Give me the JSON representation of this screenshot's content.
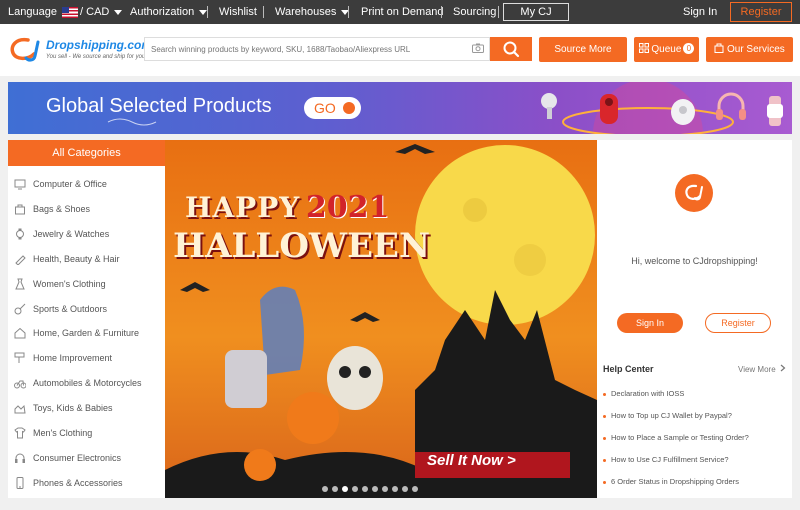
{
  "topbar": {
    "language": "Language",
    "currency": "/ CAD",
    "authorization": "Authorization",
    "wishlist": "Wishlist",
    "warehouses": "Warehouses",
    "print_on_demand": "Print on Demand",
    "sourcing": "Sourcing",
    "my_cj": "My CJ",
    "sign_in": "Sign In",
    "register": "Register"
  },
  "header": {
    "logo_text": "Dropshipping.com",
    "logo_tagline": "You sell - We source and ship for you!",
    "search_placeholder": "Search winning products by keyword, SKU, 1688/Taobao/Aliexpress URL",
    "source_more": "Source More",
    "queue": "Queue",
    "queue_count": "0",
    "our_services": "Our Services"
  },
  "banner": {
    "title": "Global Selected Products",
    "go": "GO"
  },
  "categories": {
    "heading": "All Categories",
    "items": [
      {
        "label": "Computer & Office",
        "icon": "computer-icon"
      },
      {
        "label": "Bags & Shoes",
        "icon": "bag-icon"
      },
      {
        "label": "Jewelry & Watches",
        "icon": "watch-icon"
      },
      {
        "label": "Health, Beauty & Hair",
        "icon": "beauty-icon"
      },
      {
        "label": "Women's Clothing",
        "icon": "dress-icon"
      },
      {
        "label": "Sports & Outdoors",
        "icon": "sports-icon"
      },
      {
        "label": "Home, Garden & Furniture",
        "icon": "home-icon"
      },
      {
        "label": "Home Improvement",
        "icon": "tool-icon"
      },
      {
        "label": "Automobiles & Motorcycles",
        "icon": "motorcycle-icon"
      },
      {
        "label": "Toys, Kids & Babies",
        "icon": "toy-icon"
      },
      {
        "label": "Men's Clothing",
        "icon": "shirt-icon"
      },
      {
        "label": "Consumer Electronics",
        "icon": "headphones-icon"
      },
      {
        "label": "Phones & Accessories",
        "icon": "phone-icon"
      }
    ]
  },
  "hero": {
    "line1_word": "HAPPY",
    "line1_year": "2021",
    "line2": "HALLOWEEN",
    "cta": "Sell It Now >",
    "slide_count": 10,
    "active_slide": 3
  },
  "account": {
    "welcome": "Hi, welcome to CJdropshipping!",
    "sign_in": "Sign In",
    "register": "Register"
  },
  "help": {
    "title": "Help Center",
    "view_more": "View More",
    "items": [
      "Declaration with IOSS",
      "How to Top up CJ Wallet by Paypal?",
      "How to Place a Sample or Testing Order?",
      "How to Use CJ Fulfillment Service?",
      "6 Order Status in Dropshipping Orders"
    ]
  },
  "colors": {
    "accent": "#f46a23",
    "topbar": "#3c3c3c",
    "logo_blue": "#1e88e5"
  }
}
